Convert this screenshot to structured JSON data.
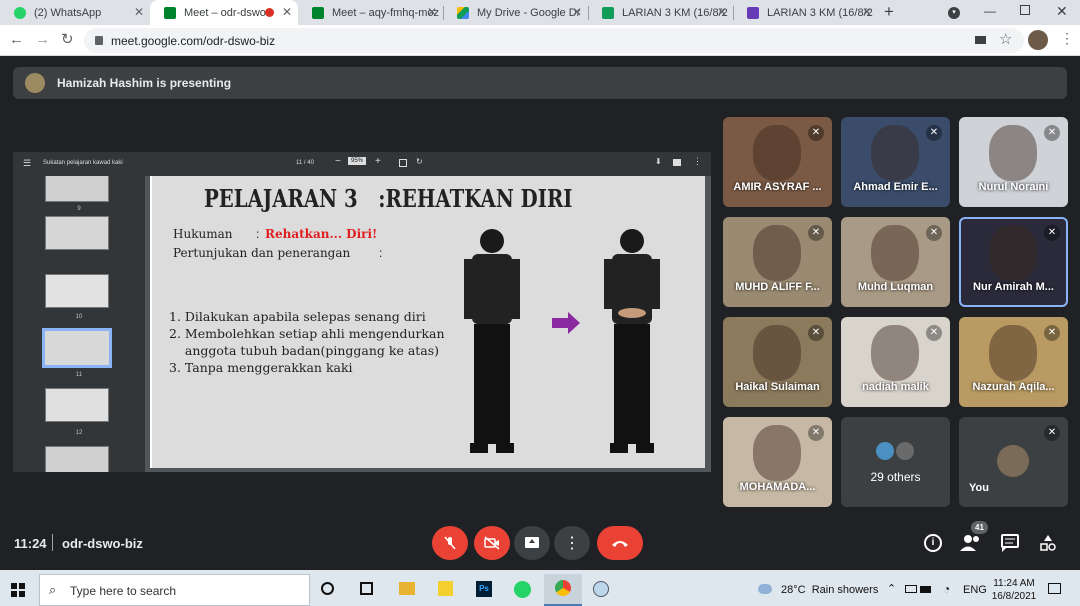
{
  "browser": {
    "tabs": [
      {
        "label": "(2) WhatsApp",
        "color": "#25d366"
      },
      {
        "label": "Meet – odr-dswo-",
        "color": "#00832d"
      },
      {
        "label": "Meet – aqy-fmhq-moz",
        "color": "#00832d"
      },
      {
        "label": "My Drive - Google Dr",
        "color": "#fbbc04"
      },
      {
        "label": "LARIAN 3 KM (16/8/2",
        "color": "#0f9d58"
      },
      {
        "label": "LARIAN 3 KM (16/8/2",
        "color": "#673ab7"
      }
    ],
    "url": "meet.google.com/odr-dswo-biz"
  },
  "meet": {
    "presenter_text": "Hamizah Hashim is presenting",
    "pdf": {
      "title": "Sukatan pelajaran kawad kaki",
      "page": "11 / 40",
      "zoom": "95%",
      "thumb_numbers": [
        "9",
        "10",
        "11",
        "12"
      ]
    },
    "slide": {
      "title": "PELAJARAN 3   :REHATKAN DIRI",
      "hukuman_label": "Hukuman",
      "hukuman_value": "Rehatkan... Diri!",
      "pertunjukan": "Pertunjukan dan penerangan",
      "points": [
        "1. Dilakukan apabila selepas senang diri",
        "2. Membolehkan setiap ahli mengendurkan",
        "    anggota tubuh badan(pinggang ke atas)",
        "3. Tanpa menggerakkan kaki"
      ]
    },
    "participants": [
      {
        "name": "AMIR ASYRAF ...",
        "color": "#7a5a44"
      },
      {
        "name": "Ahmad Emir E...",
        "color": "#3a4c6a"
      },
      {
        "name": "Nurul Noraini",
        "color": "#cfd2d6"
      },
      {
        "name": "MUHD ALIFF F...",
        "color": "#9a8a72"
      },
      {
        "name": "Muhd Luqman",
        "color": "#a99a86"
      },
      {
        "name": "Nur Amirah M...",
        "color": "#2a2a3a"
      },
      {
        "name": "Haikal Sulaiman",
        "color": "#8b7a5c"
      },
      {
        "name": "nadiah malik",
        "color": "#d8d4cc"
      },
      {
        "name": "Nazurah Aqila...",
        "color": "#b89a62"
      },
      {
        "name": "MOHAMADA...",
        "color": "#c6b8a4"
      }
    ],
    "others_label": "29 others",
    "you_label": "You",
    "time": "11:24",
    "meeting_code": "odr-dswo-biz",
    "people_count": "41"
  },
  "taskbar": {
    "search_placeholder": "Type here to search",
    "weather": "28°C  Rain showers",
    "lang": "ENG",
    "clock_time": "11:24 AM",
    "clock_date": "16/8/2021"
  }
}
